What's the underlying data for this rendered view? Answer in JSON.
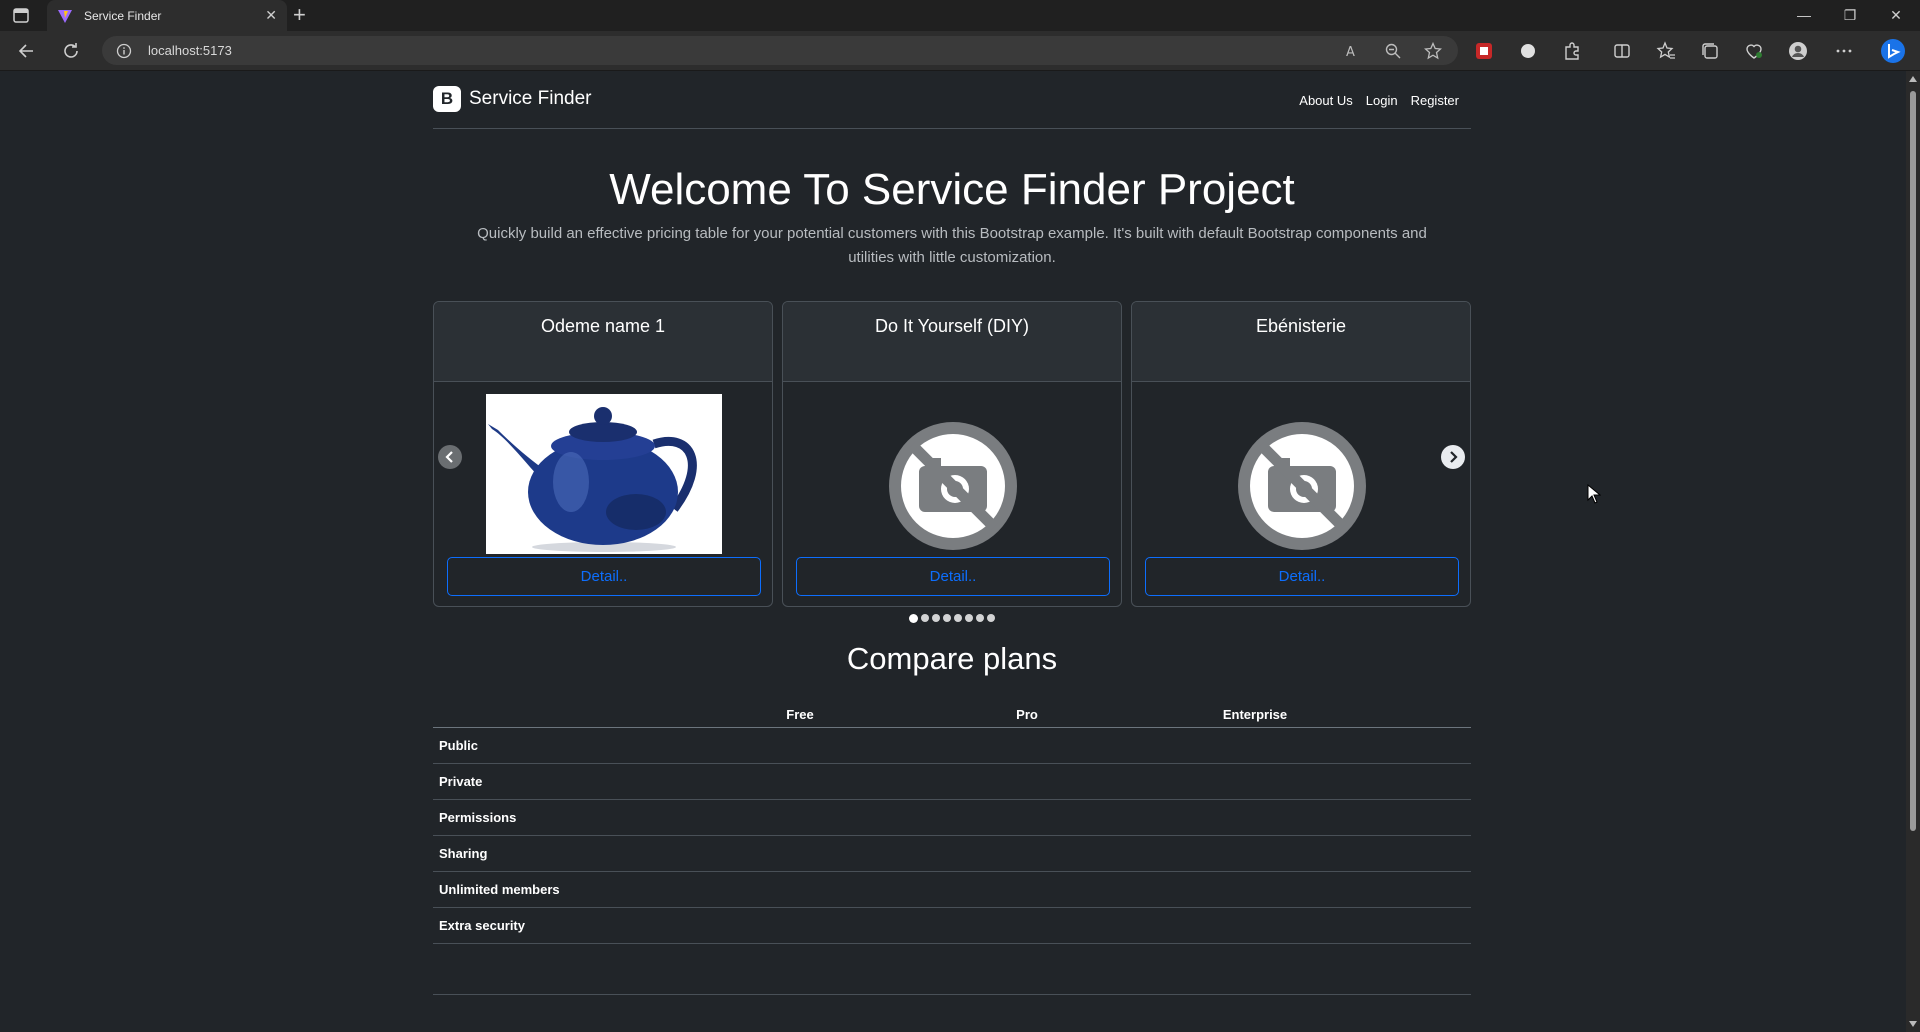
{
  "browser": {
    "tab_title": "Service Finder",
    "tab_close": "✕",
    "new_tab": "+",
    "url": "localhost:5173",
    "window_controls": {
      "minimize": "—",
      "restore": "❐",
      "close": "✕"
    }
  },
  "header": {
    "brand_logo": "B",
    "brand_name": "Service Finder",
    "nav": [
      "About Us",
      "Login",
      "Register"
    ]
  },
  "hero": {
    "title": "Welcome To Service Finder Project",
    "lead_line1": "Quickly build an effective pricing table for your potential customers with this Bootstrap example. It's built with default Bootstrap components and",
    "lead_line2": "utilities with little customization."
  },
  "carousel": {
    "cards": [
      {
        "title": "Odeme name 1",
        "image": "teapot-photo",
        "button": "Detail.."
      },
      {
        "title": "Do It Yourself (DIY)",
        "image": "no-photo-icon",
        "button": "Detail.."
      },
      {
        "title": "Ebénisterie",
        "image": "no-photo-icon",
        "button": "Detail.."
      }
    ],
    "slide_count": 8,
    "active_slide": 1
  },
  "compare": {
    "title": "Compare plans",
    "columns": [
      "Free",
      "Pro",
      "Enterprise"
    ],
    "rows": [
      "Public",
      "Private",
      "Permissions",
      "Sharing",
      "Unlimited members",
      "Extra security"
    ]
  },
  "colors": {
    "page_bg": "#212529",
    "accent": "#0d6efd",
    "border": "#495057"
  }
}
